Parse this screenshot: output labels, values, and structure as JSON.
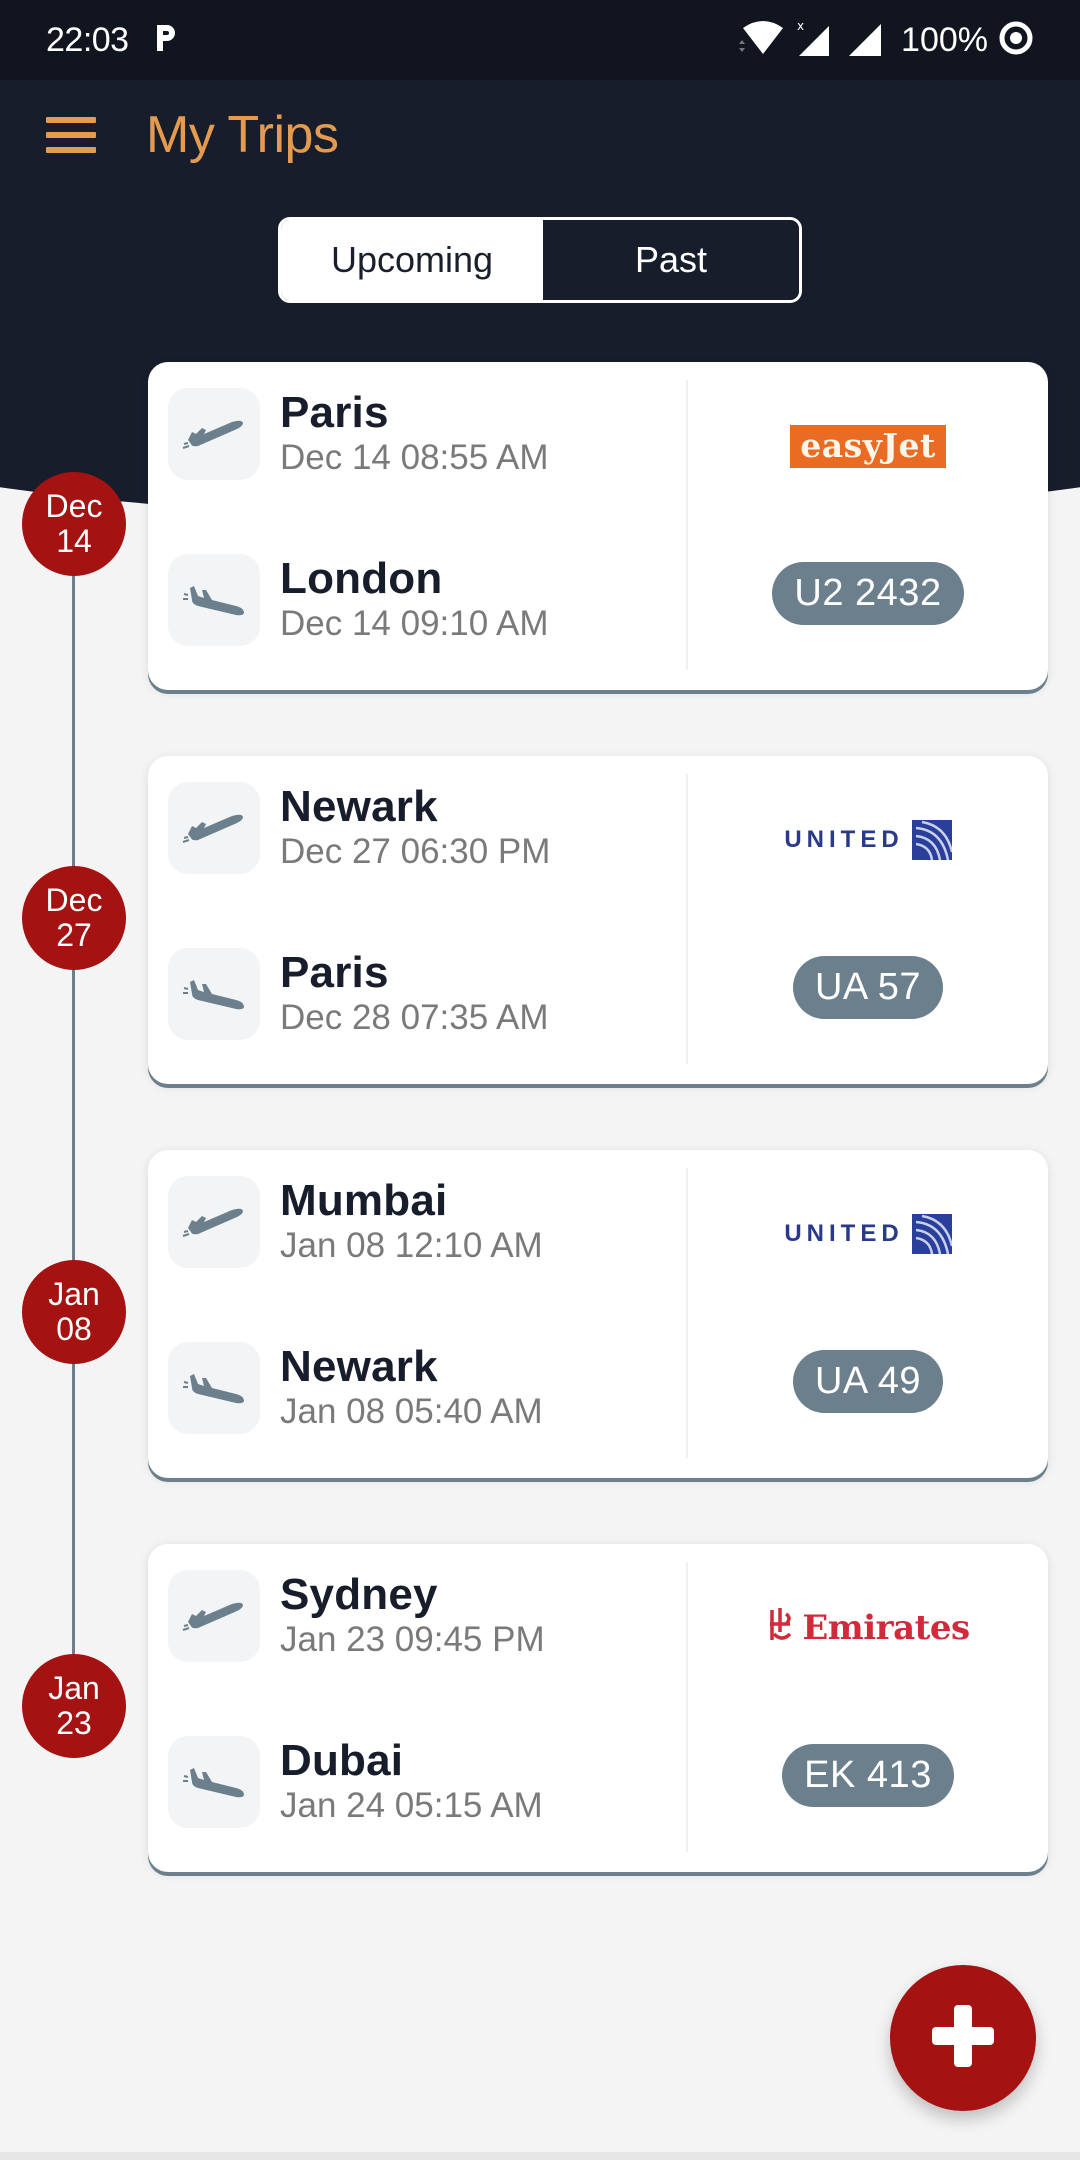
{
  "status_bar": {
    "time": "22:03",
    "notification_icon": "p-icon",
    "battery": "100%",
    "icons": [
      "wifi-icon",
      "signal-no-data-icon",
      "signal-icon",
      "sync-icon"
    ]
  },
  "app_bar": {
    "menu_icon": "hamburger-menu-icon",
    "title": "My Trips"
  },
  "tabs": {
    "upcoming": "Upcoming",
    "past": "Past",
    "active": "Upcoming"
  },
  "trips": [
    {
      "date_month": "Dec",
      "date_day": "14",
      "departure": {
        "city": "Paris",
        "time": "Dec 14 08:55 AM"
      },
      "arrival": {
        "city": "London",
        "time": "Dec 14 09:10 AM"
      },
      "airline": "easyJet",
      "flight": "U2 2432"
    },
    {
      "date_month": "Dec",
      "date_day": "27",
      "departure": {
        "city": "Newark",
        "time": "Dec 27 06:30 PM"
      },
      "arrival": {
        "city": "Paris",
        "time": "Dec 28 07:35 AM"
      },
      "airline": "UNITED",
      "flight": "UA 57"
    },
    {
      "date_month": "Jan",
      "date_day": "08",
      "departure": {
        "city": "Mumbai",
        "time": "Jan 08 12:10 AM"
      },
      "arrival": {
        "city": "Newark",
        "time": "Jan 08 05:40 AM"
      },
      "airline": "UNITED",
      "flight": "UA 49"
    },
    {
      "date_month": "Jan",
      "date_day": "23",
      "departure": {
        "city": "Sydney",
        "time": "Jan 23 09:45 PM"
      },
      "arrival": {
        "city": "Dubai",
        "time": "Jan 24 05:15 AM"
      },
      "airline": "Emirates",
      "flight": "EK 413"
    }
  ],
  "fab": {
    "icon": "plus-icon",
    "label": "Add trip"
  },
  "colors": {
    "header_bg": "#181d2c",
    "accent_orange": "#e49b4f",
    "badge_red": "#a41212",
    "pill_slate": "#6b808c",
    "easyjet_orange": "#ea6b22",
    "united_blue": "#2a3a8a",
    "emirates_red": "#d22a3a"
  }
}
